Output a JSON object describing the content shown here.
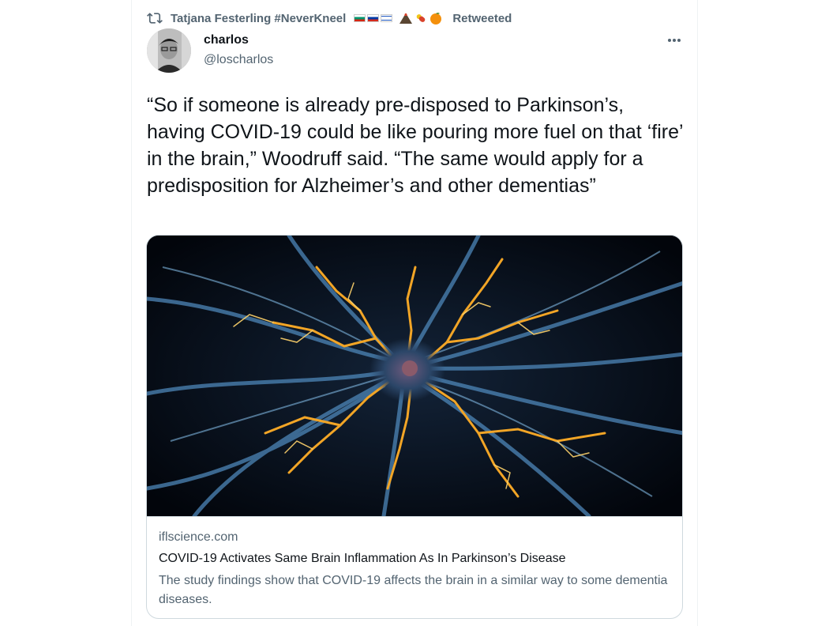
{
  "retweet": {
    "retweeter": "Tatjana Festerling #NeverKneel",
    "label": "Retweeted",
    "icon": "retweet-icon",
    "emojis": [
      "bulgarian-flag-icon",
      "russian-flag-icon",
      "israeli-flag-icon",
      "volcano-icon",
      "pill-icon",
      "orange-icon"
    ]
  },
  "author": {
    "name": "charlos",
    "handle": "@loscharlos",
    "avatar_icon": "avatar"
  },
  "tweet": {
    "text": "“So if someone is already pre-disposed to Parkinson’s, having COVID-19 could be like pouring more fuel on that ‘fire’ in the brain,” Woodruff said. “The same would apply for a predisposition for Alzheimer’s and other dementias”"
  },
  "card": {
    "domain": "iflscience.com",
    "title": "COVID-19 Activates Same Brain Inflammation As In Parkinson’s Disease",
    "description": "The study findings show that COVID-19 affects the brain in a similar way to some dementia diseases."
  },
  "colors": {
    "secondary_text": "#536471",
    "primary_text": "#0f1419",
    "border": "#cfd9de"
  }
}
